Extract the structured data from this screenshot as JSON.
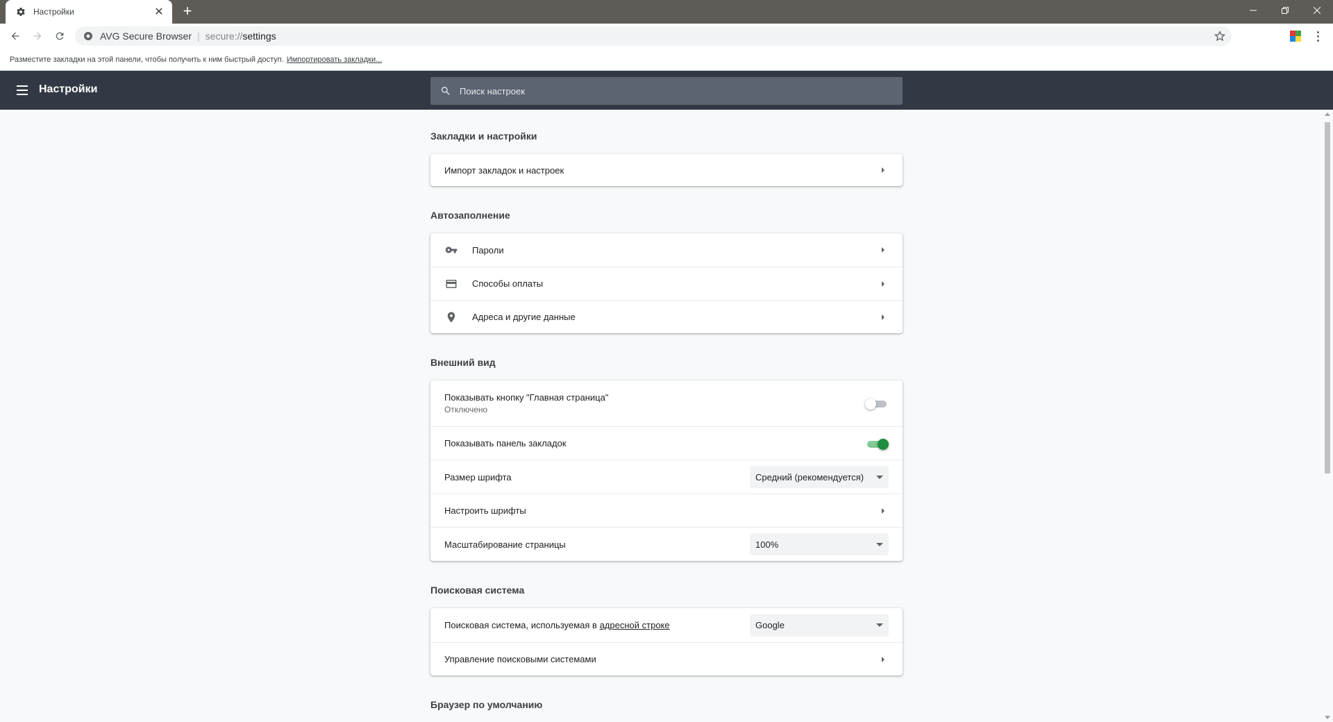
{
  "tab": {
    "title": "Настройки",
    "icon": "gear-icon"
  },
  "window_controls": {
    "minimize_icon": "minimize-icon",
    "restore_icon": "restore-icon",
    "close_icon": "close-icon"
  },
  "toolbar": {
    "site_name": "AVG Secure Browser",
    "url_scheme": "secure://",
    "url_path": "settings"
  },
  "bookmarks_bar": {
    "hint": "Разместите закладки на этой панели, чтобы получить к ним быстрый доступ.",
    "import_link": "Импортировать закладки..."
  },
  "header": {
    "title": "Настройки",
    "search_placeholder": "Поиск настроек"
  },
  "sections": {
    "bookmarks": {
      "title": "Закладки и настройки",
      "import_label": "Импорт закладок и настроек"
    },
    "autofill": {
      "title": "Автозаполнение",
      "passwords": "Пароли",
      "payment": "Способы оплаты",
      "addresses": "Адреса и другие данные"
    },
    "appearance": {
      "title": "Внешний вид",
      "home_button_label": "Показывать кнопку \"Главная страница\"",
      "home_button_status": "Отключено",
      "home_button_enabled": false,
      "bookmarks_bar_label": "Показывать панель закладок",
      "bookmarks_bar_enabled": true,
      "font_size_label": "Размер шрифта",
      "font_size_value": "Средний (рекомендуется)",
      "customize_fonts_label": "Настроить шрифты",
      "zoom_label": "Масштабирование страницы",
      "zoom_value": "100%"
    },
    "search": {
      "title": "Поисковая система",
      "engine_label_prefix": "Поисковая система, используемая в ",
      "engine_label_link": "адресной строке",
      "engine_value": "Google",
      "manage_label": "Управление поисковыми системами"
    },
    "default_browser": {
      "title": "Браузер по умолчанию"
    }
  },
  "colors": {
    "header_bg": "#323945",
    "toggle_on": "#1e8e3e",
    "tabstrip_bg": "#5f5b56"
  }
}
